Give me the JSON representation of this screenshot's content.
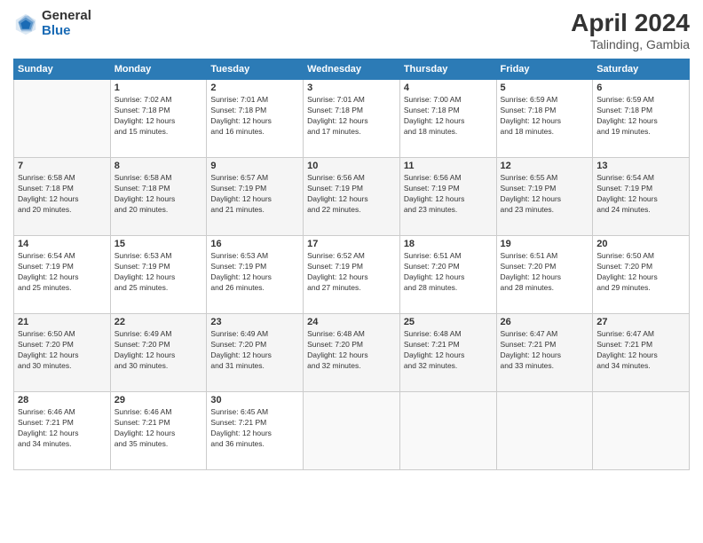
{
  "header": {
    "logo_general": "General",
    "logo_blue": "Blue",
    "month_year": "April 2024",
    "location": "Talinding, Gambia"
  },
  "days_of_week": [
    "Sunday",
    "Monday",
    "Tuesday",
    "Wednesday",
    "Thursday",
    "Friday",
    "Saturday"
  ],
  "weeks": [
    [
      {
        "day": "",
        "sunrise": "",
        "sunset": "",
        "daylight": ""
      },
      {
        "day": "1",
        "sunrise": "7:02 AM",
        "sunset": "7:18 PM",
        "daylight": "12 hours and 15 minutes."
      },
      {
        "day": "2",
        "sunrise": "7:01 AM",
        "sunset": "7:18 PM",
        "daylight": "12 hours and 16 minutes."
      },
      {
        "day": "3",
        "sunrise": "7:01 AM",
        "sunset": "7:18 PM",
        "daylight": "12 hours and 17 minutes."
      },
      {
        "day": "4",
        "sunrise": "7:00 AM",
        "sunset": "7:18 PM",
        "daylight": "12 hours and 18 minutes."
      },
      {
        "day": "5",
        "sunrise": "6:59 AM",
        "sunset": "7:18 PM",
        "daylight": "12 hours and 18 minutes."
      },
      {
        "day": "6",
        "sunrise": "6:59 AM",
        "sunset": "7:18 PM",
        "daylight": "12 hours and 19 minutes."
      }
    ],
    [
      {
        "day": "7",
        "sunrise": "6:58 AM",
        "sunset": "7:18 PM",
        "daylight": "12 hours and 20 minutes."
      },
      {
        "day": "8",
        "sunrise": "6:58 AM",
        "sunset": "7:18 PM",
        "daylight": "12 hours and 20 minutes."
      },
      {
        "day": "9",
        "sunrise": "6:57 AM",
        "sunset": "7:19 PM",
        "daylight": "12 hours and 21 minutes."
      },
      {
        "day": "10",
        "sunrise": "6:56 AM",
        "sunset": "7:19 PM",
        "daylight": "12 hours and 22 minutes."
      },
      {
        "day": "11",
        "sunrise": "6:56 AM",
        "sunset": "7:19 PM",
        "daylight": "12 hours and 23 minutes."
      },
      {
        "day": "12",
        "sunrise": "6:55 AM",
        "sunset": "7:19 PM",
        "daylight": "12 hours and 23 minutes."
      },
      {
        "day": "13",
        "sunrise": "6:54 AM",
        "sunset": "7:19 PM",
        "daylight": "12 hours and 24 minutes."
      }
    ],
    [
      {
        "day": "14",
        "sunrise": "6:54 AM",
        "sunset": "7:19 PM",
        "daylight": "12 hours and 25 minutes."
      },
      {
        "day": "15",
        "sunrise": "6:53 AM",
        "sunset": "7:19 PM",
        "daylight": "12 hours and 25 minutes."
      },
      {
        "day": "16",
        "sunrise": "6:53 AM",
        "sunset": "7:19 PM",
        "daylight": "12 hours and 26 minutes."
      },
      {
        "day": "17",
        "sunrise": "6:52 AM",
        "sunset": "7:19 PM",
        "daylight": "12 hours and 27 minutes."
      },
      {
        "day": "18",
        "sunrise": "6:51 AM",
        "sunset": "7:20 PM",
        "daylight": "12 hours and 28 minutes."
      },
      {
        "day": "19",
        "sunrise": "6:51 AM",
        "sunset": "7:20 PM",
        "daylight": "12 hours and 28 minutes."
      },
      {
        "day": "20",
        "sunrise": "6:50 AM",
        "sunset": "7:20 PM",
        "daylight": "12 hours and 29 minutes."
      }
    ],
    [
      {
        "day": "21",
        "sunrise": "6:50 AM",
        "sunset": "7:20 PM",
        "daylight": "12 hours and 30 minutes."
      },
      {
        "day": "22",
        "sunrise": "6:49 AM",
        "sunset": "7:20 PM",
        "daylight": "12 hours and 30 minutes."
      },
      {
        "day": "23",
        "sunrise": "6:49 AM",
        "sunset": "7:20 PM",
        "daylight": "12 hours and 31 minutes."
      },
      {
        "day": "24",
        "sunrise": "6:48 AM",
        "sunset": "7:20 PM",
        "daylight": "12 hours and 32 minutes."
      },
      {
        "day": "25",
        "sunrise": "6:48 AM",
        "sunset": "7:21 PM",
        "daylight": "12 hours and 32 minutes."
      },
      {
        "day": "26",
        "sunrise": "6:47 AM",
        "sunset": "7:21 PM",
        "daylight": "12 hours and 33 minutes."
      },
      {
        "day": "27",
        "sunrise": "6:47 AM",
        "sunset": "7:21 PM",
        "daylight": "12 hours and 34 minutes."
      }
    ],
    [
      {
        "day": "28",
        "sunrise": "6:46 AM",
        "sunset": "7:21 PM",
        "daylight": "12 hours and 34 minutes."
      },
      {
        "day": "29",
        "sunrise": "6:46 AM",
        "sunset": "7:21 PM",
        "daylight": "12 hours and 35 minutes."
      },
      {
        "day": "30",
        "sunrise": "6:45 AM",
        "sunset": "7:21 PM",
        "daylight": "12 hours and 36 minutes."
      },
      {
        "day": "",
        "sunrise": "",
        "sunset": "",
        "daylight": ""
      },
      {
        "day": "",
        "sunrise": "",
        "sunset": "",
        "daylight": ""
      },
      {
        "day": "",
        "sunrise": "",
        "sunset": "",
        "daylight": ""
      },
      {
        "day": "",
        "sunrise": "",
        "sunset": "",
        "daylight": ""
      }
    ]
  ]
}
